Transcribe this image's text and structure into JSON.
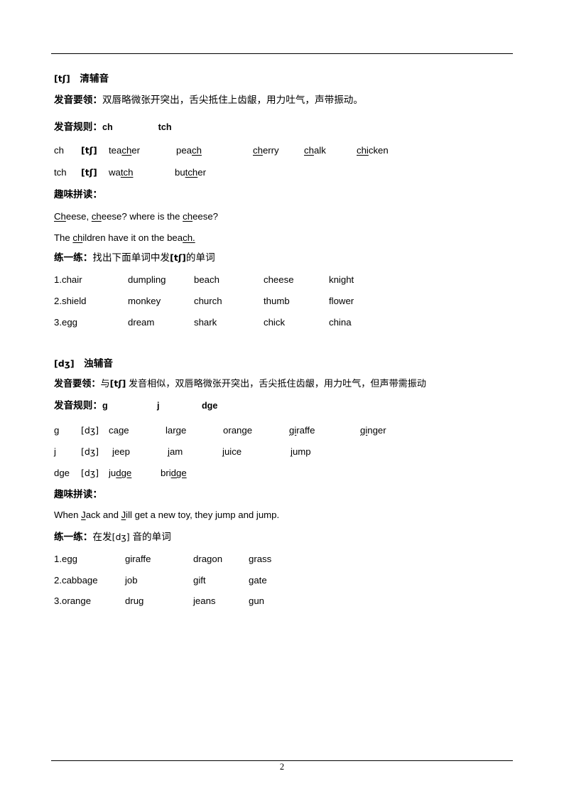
{
  "page": {
    "number": "2"
  },
  "sections": [
    {
      "id": "tch",
      "heading_symbol": "[tʃ]",
      "heading_text": "清辅音",
      "key_points_label": "发音要领：",
      "key_points_text": "双唇略微张开突出，舌尖抵住上齿龈，用力吐气，声带振动。",
      "rules_label": "发音规则：",
      "rule_keys": [
        "ch",
        "tch"
      ],
      "rule_rows": [
        {
          "key": "ch",
          "ipa": "[tʃ]",
          "words": [
            {
              "pre": "tea",
              "mid": "ch",
              "post": "er"
            },
            {
              "pre": "pea",
              "mid": "ch",
              "post": ""
            },
            {
              "pre": "",
              "mid": "ch",
              "post": "erry"
            },
            {
              "pre": "",
              "mid": "ch",
              "post": "alk"
            },
            {
              "pre": "",
              "mid": "chi",
              "post": "cken"
            }
          ]
        },
        {
          "key": "tch",
          "ipa": "[tʃ]",
          "words": [
            {
              "pre": "wa",
              "mid": "tch",
              "post": ""
            },
            {
              "pre": "bu",
              "mid": "tch",
              "post": "er"
            }
          ]
        }
      ],
      "fun_label": "趣味拼读：",
      "fun_lines": [
        [
          {
            "t": "C",
            "u": true
          },
          {
            "t": "h",
            "u": true
          },
          {
            "t": "eese, ",
            "u": false
          },
          {
            "t": "ch",
            "u": true
          },
          {
            "t": "eese? where is the ",
            "u": false
          },
          {
            "t": "ch",
            "u": true
          },
          {
            "t": "eese?",
            "u": false
          }
        ],
        [
          {
            "t": "The ",
            "u": false
          },
          {
            "t": "ch",
            "u": true
          },
          {
            "t": "ildren have it on the bea",
            "u": false
          },
          {
            "t": "ch.",
            "u": true
          }
        ]
      ],
      "practice_label": "练一练：",
      "practice_text_pre": "找出下面单词中发",
      "practice_symbol": "[tʃ]",
      "practice_text_post": "的单词",
      "practice_rows": [
        [
          "1.chair",
          "dumpling",
          "beach",
          "cheese",
          "knight"
        ],
        [
          "2.shield",
          "monkey",
          "church",
          "thumb",
          "flower"
        ],
        [
          "3.egg",
          "dream",
          "shark",
          "chick",
          "china"
        ]
      ]
    },
    {
      "id": "dj",
      "heading_symbol": "[dʒ]",
      "heading_text": "浊辅音",
      "key_points_label": "发音要领：",
      "key_points_prefix": "与",
      "key_points_symbol": "[tʃ]",
      "key_points_text": " 发音相似，双唇略微张开突出，舌尖抵住齿龈，用力吐气，但声带需振动",
      "rules_label": "发音规则：",
      "rule_keys": [
        "g",
        "j",
        "dge"
      ],
      "rule_rows": [
        {
          "key": "g",
          "ipa": "[dʒ]",
          "words": [
            {
              "pre": "ca",
              "mid": "g",
              "post": "e"
            },
            {
              "pre": "lar",
              "mid": "g",
              "post": "e"
            },
            {
              "pre": "oran",
              "mid": "g",
              "post": "e"
            },
            {
              "pre": "",
              "mid": "gi",
              "post": "raffe"
            },
            {
              "pre": "",
              "mid": "gi",
              "post": "nger"
            }
          ]
        },
        {
          "key": "j",
          "ipa": "[dʒ]",
          "words": [
            {
              "pre": "",
              "mid": "j",
              "post": "eep"
            },
            {
              "pre": "",
              "mid": "j",
              "post": "am"
            },
            {
              "pre": "",
              "mid": "j",
              "post": "uice"
            },
            {
              "pre": "",
              "mid": "j",
              "post": "ump"
            }
          ]
        },
        {
          "key": "dge",
          "ipa": "[dʒ]",
          "words": [
            {
              "pre": "ju",
              "mid": "dge",
              "post": ""
            },
            {
              "pre": "bri",
              "mid": "dge",
              "post": ""
            }
          ]
        }
      ],
      "fun_label": "趣味拼读：",
      "fun_lines": [
        [
          {
            "t": "When ",
            "u": false
          },
          {
            "t": "J",
            "u": true
          },
          {
            "t": "ack and ",
            "u": false
          },
          {
            "t": "J",
            "u": true
          },
          {
            "t": "ill get a new toy, they jump and jump.",
            "u": false
          }
        ]
      ],
      "practice_label": "练一练：",
      "practice_text_pre": "在发",
      "practice_symbol": "[dʒ]",
      "practice_text_post": " 音的单词",
      "practice_rows": [
        [
          "1.egg",
          "giraffe",
          "dragon",
          "grass"
        ],
        [
          "2.cabbage",
          "job",
          "gift",
          "gate"
        ],
        [
          "3.orange",
          "drug",
          "jeans",
          "gun"
        ]
      ]
    }
  ]
}
